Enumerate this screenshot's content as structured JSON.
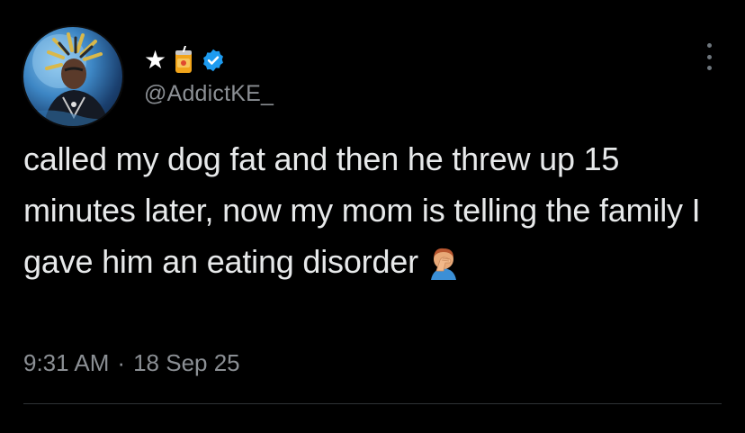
{
  "tweet": {
    "display_name_star": "★",
    "handle": "@AddictKE_",
    "text": "called my dog fat and then he threw up 15 minutes later, now my mom is telling the family I gave him an eating disorder",
    "time": "9:31 AM",
    "separator": "·",
    "date": "18 Sep 25"
  },
  "icons": {
    "name_emoji": "beverage-can-icon",
    "verified": "verified-badge-icon",
    "more": "more-vertical-icon",
    "text_emoji": "man-facepalming-icon"
  },
  "colors": {
    "background": "#000000",
    "text": "#e7e9ea",
    "secondary": "#8b8f94",
    "verified": "#1d9bf0"
  }
}
